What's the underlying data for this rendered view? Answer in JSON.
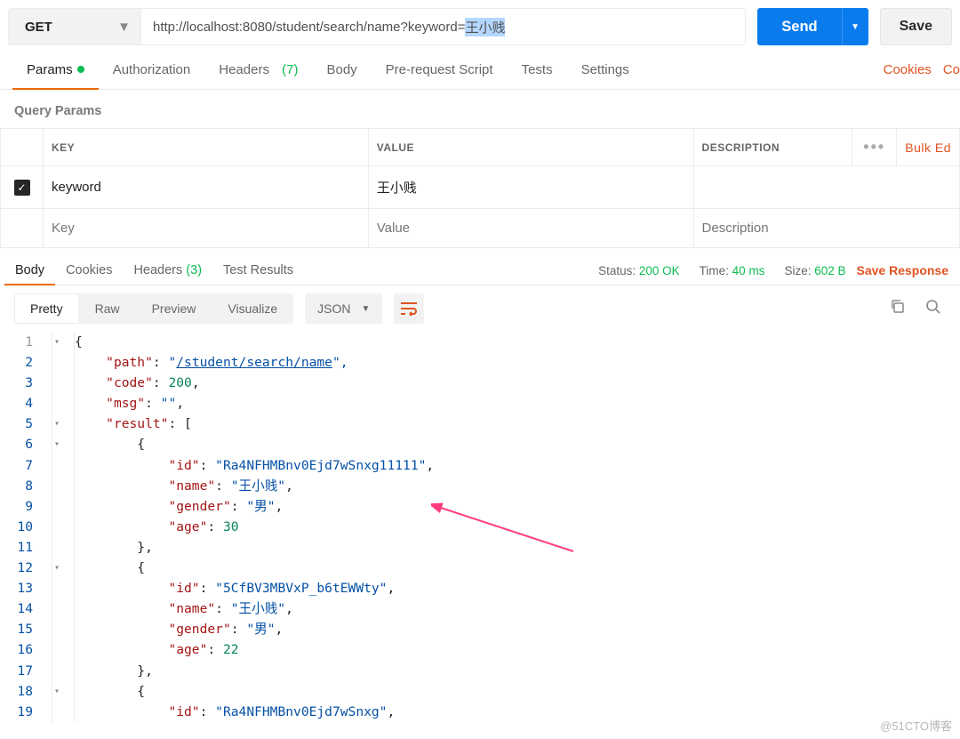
{
  "request": {
    "method": "GET",
    "url_prefix": "http://localhost:8080/student/search/name?keyword=",
    "url_highlight": "王小贱",
    "send": "Send",
    "save": "Save"
  },
  "tabs": {
    "params": "Params",
    "auth": "Authorization",
    "headers": "Headers",
    "headers_count": "(7)",
    "body": "Body",
    "prerequest": "Pre-request Script",
    "tests": "Tests",
    "settings": "Settings",
    "cookies": "Cookies",
    "code": "Co"
  },
  "query": {
    "title": "Query Params",
    "k": "KEY",
    "v": "VALUE",
    "d": "DESCRIPTION",
    "bulk": "Bulk Ed",
    "row_key": "keyword",
    "row_val": "王小贱",
    "ph_k": "Key",
    "ph_v": "Value",
    "ph_d": "Description"
  },
  "resp": {
    "body": "Body",
    "cookies": "Cookies",
    "headers": "Headers",
    "headers_count": "(3)",
    "tests": "Test Results",
    "status_lbl": "Status:",
    "status_val": "200 OK",
    "time_lbl": "Time:",
    "time_val": "40 ms",
    "size_lbl": "Size:",
    "size_val": "602 B",
    "save": "Save Response"
  },
  "view": {
    "pretty": "Pretty",
    "raw": "Raw",
    "preview": "Preview",
    "visualize": "Visualize",
    "fmt": "JSON"
  },
  "json_body": {
    "path": "/student/search/name",
    "code": 200,
    "msg": "",
    "result": [
      {
        "id": "Ra4NFHMBnv0Ejd7wSnxg11111",
        "name": "王小贱",
        "gender": "男",
        "age": 30
      },
      {
        "id": "5CfBV3MBVxP_b6tEWWty",
        "name": "王小贱",
        "gender": "男",
        "age": 22
      },
      {
        "id": "Ra4NFHMBnv0Ejd7wSnxg"
      }
    ]
  },
  "lines": {
    "l1n": "1",
    "l1": "{",
    "l2n": "2",
    "l2a": "    ",
    "l2k": "\"path\"",
    "l2c": ": ",
    "l2q": "\"",
    "l2v": "/student/search/name",
    "l2e": "\",",
    "l3n": "3",
    "l3a": "    ",
    "l3k": "\"code\"",
    "l3c": ": ",
    "l3v": "200",
    "l3e": ",",
    "l4n": "4",
    "l4a": "    ",
    "l4k": "\"msg\"",
    "l4c": ": ",
    "l4v": "\"\"",
    "l4e": ",",
    "l5n": "5",
    "l5a": "    ",
    "l5k": "\"result\"",
    "l5c": ": [",
    "l6n": "6",
    "l6": "        {",
    "l7n": "7",
    "l7a": "            ",
    "l7k": "\"id\"",
    "l7c": ": ",
    "l7v": "\"Ra4NFHMBnv0Ejd7wSnxg11111\"",
    "l7e": ",",
    "l8n": "8",
    "l8a": "            ",
    "l8k": "\"name\"",
    "l8c": ": ",
    "l8v": "\"王小贱\"",
    "l8e": ",",
    "l9n": "9",
    "l9a": "            ",
    "l9k": "\"gender\"",
    "l9c": ": ",
    "l9v": "\"男\"",
    "l9e": ",",
    "l10n": "10",
    "l10a": "            ",
    "l10k": "\"age\"",
    "l10c": ": ",
    "l10v": "30",
    "l11n": "11",
    "l11": "        },",
    "l12n": "12",
    "l12": "        {",
    "l13n": "13",
    "l13a": "            ",
    "l13k": "\"id\"",
    "l13c": ": ",
    "l13v": "\"5CfBV3MBVxP_b6tEWWty\"",
    "l13e": ",",
    "l14n": "14",
    "l14a": "            ",
    "l14k": "\"name\"",
    "l14c": ": ",
    "l14v": "\"王小贱\"",
    "l14e": ",",
    "l15n": "15",
    "l15a": "            ",
    "l15k": "\"gender\"",
    "l15c": ": ",
    "l15v": "\"男\"",
    "l15e": ",",
    "l16n": "16",
    "l16a": "            ",
    "l16k": "\"age\"",
    "l16c": ": ",
    "l16v": "22",
    "l17n": "17",
    "l17": "        },",
    "l18n": "18",
    "l18": "        {",
    "l19n": "19",
    "l19a": "            ",
    "l19k": "\"id\"",
    "l19c": ": ",
    "l19v": "\"Ra4NFHMBnv0Ejd7wSnxg\"",
    "l19e": ","
  },
  "watermark": "@51CTO博客"
}
